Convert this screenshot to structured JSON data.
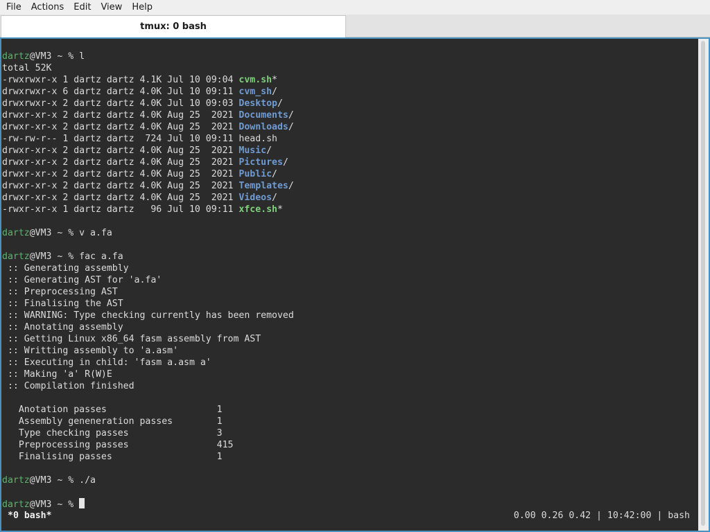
{
  "menubar": {
    "items": [
      "File",
      "Actions",
      "Edit",
      "View",
      "Help"
    ]
  },
  "tab": {
    "title": "tmux: 0 bash"
  },
  "terminal": {
    "lines": [
      [],
      [
        {
          "t": "dartz",
          "c": "user"
        },
        {
          "t": "@VM3 ~ % l"
        }
      ],
      [
        {
          "t": "total 52K"
        }
      ],
      [
        {
          "t": "-rwxrwxr-x 1 dartz dartz 4.1K Jul 10 09:04 "
        },
        {
          "t": "cvm.sh",
          "c": "exec"
        },
        {
          "t": "*"
        }
      ],
      [
        {
          "t": "drwxrwxr-x 6 dartz dartz 4.0K Jul 10 09:11 "
        },
        {
          "t": "cvm_sh",
          "c": "dir"
        },
        {
          "t": "/"
        }
      ],
      [
        {
          "t": "drwxrwxr-x 2 dartz dartz 4.0K Jul 10 09:03 "
        },
        {
          "t": "Desktop",
          "c": "dir"
        },
        {
          "t": "/"
        }
      ],
      [
        {
          "t": "drwxr-xr-x 2 dartz dartz 4.0K Aug 25  2021 "
        },
        {
          "t": "Documents",
          "c": "dir"
        },
        {
          "t": "/"
        }
      ],
      [
        {
          "t": "drwxr-xr-x 2 dartz dartz 4.0K Aug 25  2021 "
        },
        {
          "t": "Downloads",
          "c": "dir"
        },
        {
          "t": "/"
        }
      ],
      [
        {
          "t": "-rw-rw-r-- 1 dartz dartz  724 Jul 10 09:11 head.sh"
        }
      ],
      [
        {
          "t": "drwxr-xr-x 2 dartz dartz 4.0K Aug 25  2021 "
        },
        {
          "t": "Music",
          "c": "dir"
        },
        {
          "t": "/"
        }
      ],
      [
        {
          "t": "drwxr-xr-x 2 dartz dartz 4.0K Aug 25  2021 "
        },
        {
          "t": "Pictures",
          "c": "dir"
        },
        {
          "t": "/"
        }
      ],
      [
        {
          "t": "drwxr-xr-x 2 dartz dartz 4.0K Aug 25  2021 "
        },
        {
          "t": "Public",
          "c": "dir"
        },
        {
          "t": "/"
        }
      ],
      [
        {
          "t": "drwxr-xr-x 2 dartz dartz 4.0K Aug 25  2021 "
        },
        {
          "t": "Templates",
          "c": "dir"
        },
        {
          "t": "/"
        }
      ],
      [
        {
          "t": "drwxr-xr-x 2 dartz dartz 4.0K Aug 25  2021 "
        },
        {
          "t": "Videos",
          "c": "dir"
        },
        {
          "t": "/"
        }
      ],
      [
        {
          "t": "-rwxr-xr-x 1 dartz dartz   96 Jul 10 09:11 "
        },
        {
          "t": "xfce.sh",
          "c": "exec"
        },
        {
          "t": "*"
        }
      ],
      [],
      [
        {
          "t": "dartz",
          "c": "user"
        },
        {
          "t": "@VM3 ~ % v a.fa"
        }
      ],
      [],
      [
        {
          "t": "dartz",
          "c": "user"
        },
        {
          "t": "@VM3 ~ % fac a.fa"
        }
      ],
      [
        {
          "t": " :: Generating assembly"
        }
      ],
      [
        {
          "t": " :: Generating AST for 'a.fa'"
        }
      ],
      [
        {
          "t": " :: Preprocessing AST"
        }
      ],
      [
        {
          "t": " :: Finalising the AST"
        }
      ],
      [
        {
          "t": " :: WARNING: Type checking currently has been removed"
        }
      ],
      [
        {
          "t": " :: Anotating assembly"
        }
      ],
      [
        {
          "t": " :: Getting Linux x86_64 fasm assembly from AST"
        }
      ],
      [
        {
          "t": " :: Writting assembly to 'a.asm'"
        }
      ],
      [
        {
          "t": " :: Executing in child: 'fasm a.asm a'"
        }
      ],
      [
        {
          "t": " :: Making 'a' R(W)E"
        }
      ],
      [
        {
          "t": " :: Compilation finished"
        }
      ],
      [],
      [
        {
          "t": "   Anotation passes                    1"
        }
      ],
      [
        {
          "t": "   Assembly geneneration passes        1"
        }
      ],
      [
        {
          "t": "   Type checking passes                3"
        }
      ],
      [
        {
          "t": "   Preprocessing passes                415"
        }
      ],
      [
        {
          "t": "   Finalising passes                   1"
        }
      ],
      [],
      [
        {
          "t": "dartz",
          "c": "user"
        },
        {
          "t": "@VM3 ~ % ./a"
        }
      ],
      [],
      [
        {
          "t": "dartz",
          "c": "user"
        },
        {
          "t": "@VM3 ~ % "
        },
        {
          "t": "",
          "c": "cursor"
        }
      ]
    ]
  },
  "status": {
    "window": "*0 bash*",
    "right": "0.00 0.26 0.42 | 10:42:00 | bash"
  },
  "colors": {
    "terminal_bg": "#2b2b2b",
    "user": "#5fb36e",
    "directory": "#6f9bd4",
    "executable": "#7ed07c",
    "frame_accent": "#4a90c0"
  }
}
